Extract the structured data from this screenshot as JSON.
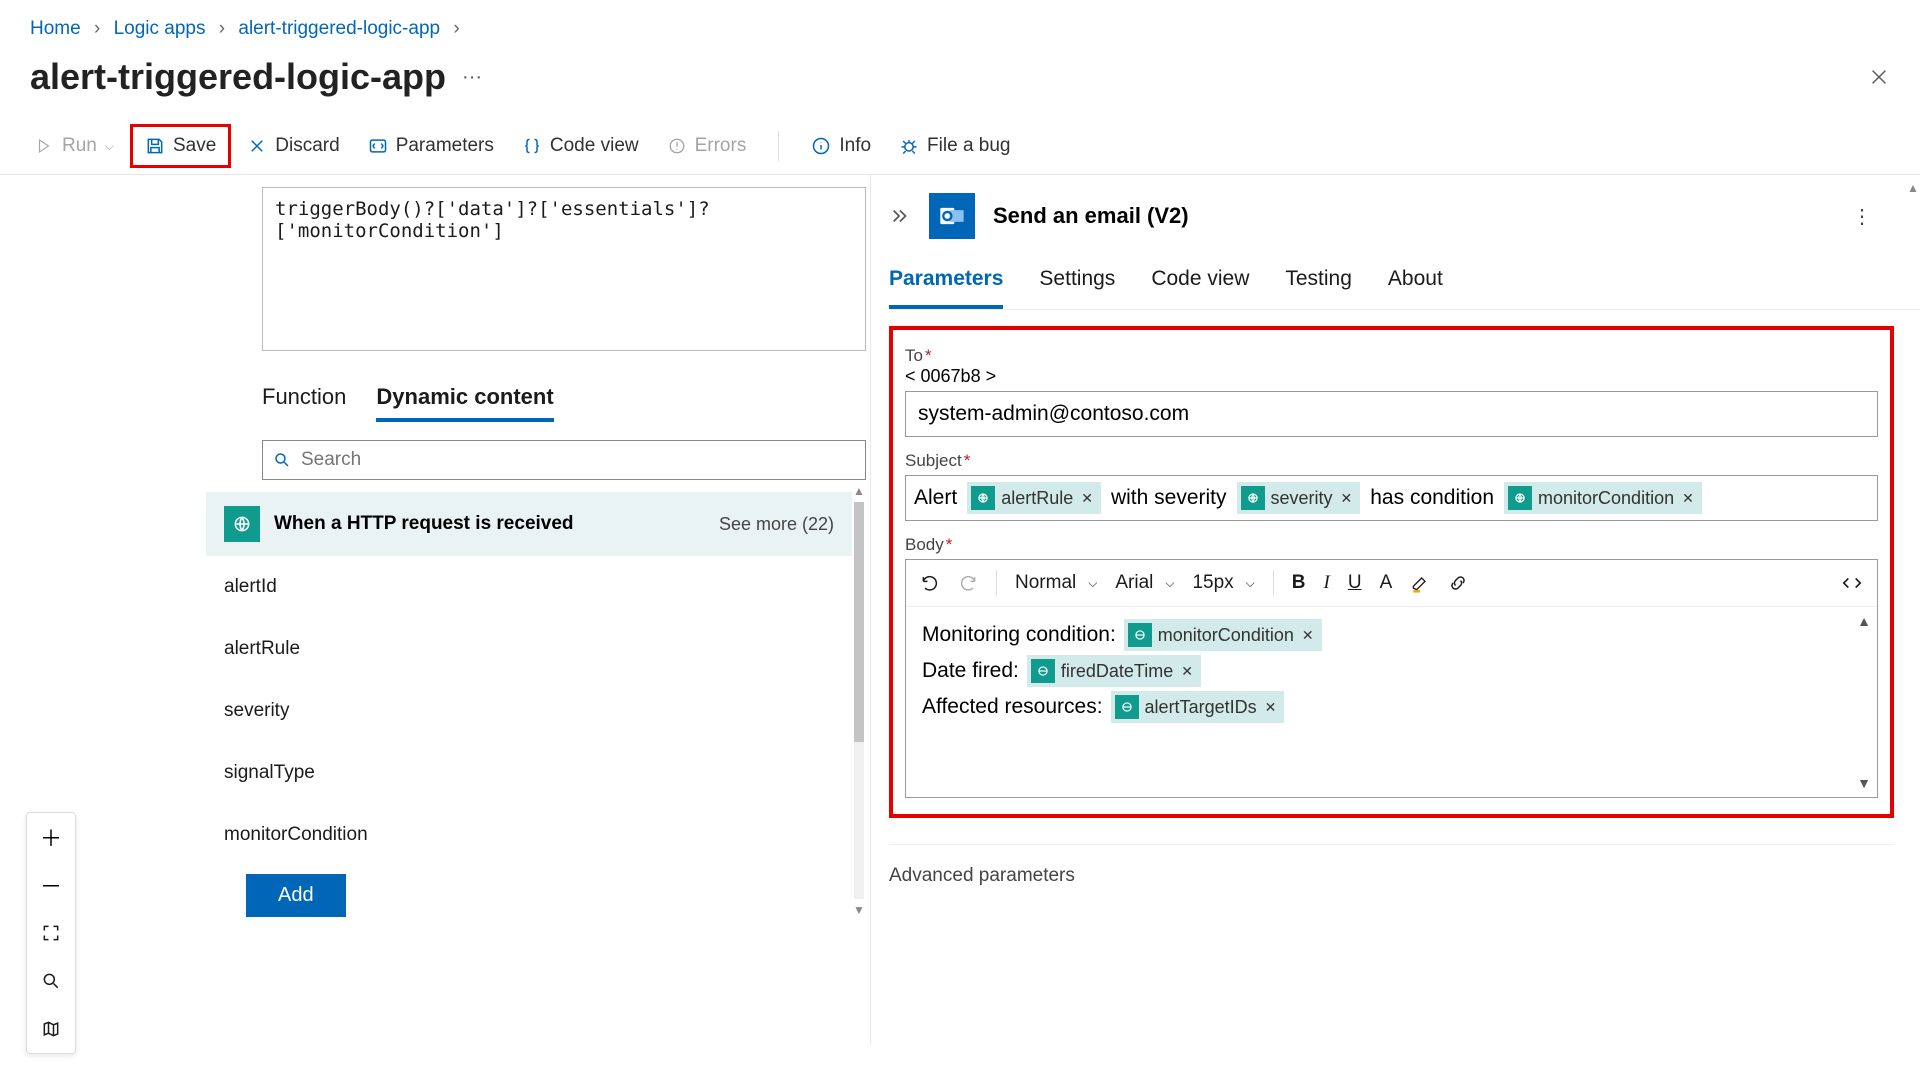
{
  "breadcrumb": {
    "home": "Home",
    "logicapps": "Logic apps",
    "app": "alert-triggered-logic-app"
  },
  "title": "alert-triggered-logic-app",
  "toolbar": {
    "run": "Run",
    "save": "Save",
    "discard": "Discard",
    "parameters": "Parameters",
    "codeview": "Code view",
    "errors": "Errors",
    "info": "Info",
    "bug": "File a bug"
  },
  "expression": "triggerBody()?['data']?['essentials']?['monitorCondition']",
  "left_tabs": {
    "function": "Function",
    "dynamic": "Dynamic content"
  },
  "search": {
    "placeholder": "Search"
  },
  "dc_section": {
    "label": "When a HTTP request is received",
    "seemore": "See more (22)"
  },
  "dc_items": [
    "alertId",
    "alertRule",
    "severity",
    "signalType",
    "monitorCondition"
  ],
  "add_button": "Add",
  "action": {
    "title": "Send an email (V2)"
  },
  "rtabs": {
    "parameters": "Parameters",
    "settings": "Settings",
    "codeview": "Code view",
    "testing": "Testing",
    "about": "About"
  },
  "form": {
    "to_label": "To",
    "to_value": "system-admin@contoso.com",
    "subject_label": "Subject",
    "subject_parts": {
      "t1": "Alert",
      "tok1": "alertRule",
      "t2": "with severity",
      "tok2": "severity",
      "t3": "has condition",
      "tok3": "monitorCondition"
    },
    "body_label": "Body",
    "body_lines": {
      "l1": "Monitoring condition:",
      "tok1": "monitorCondition",
      "l2": "Date fired:",
      "tok2": "firedDateTime",
      "l3": "Affected resources:",
      "tok3": "alertTargetIDs"
    }
  },
  "editor_controls": {
    "style": "Normal",
    "font": "Arial",
    "size": "15px"
  },
  "advanced": "Advanced parameters"
}
